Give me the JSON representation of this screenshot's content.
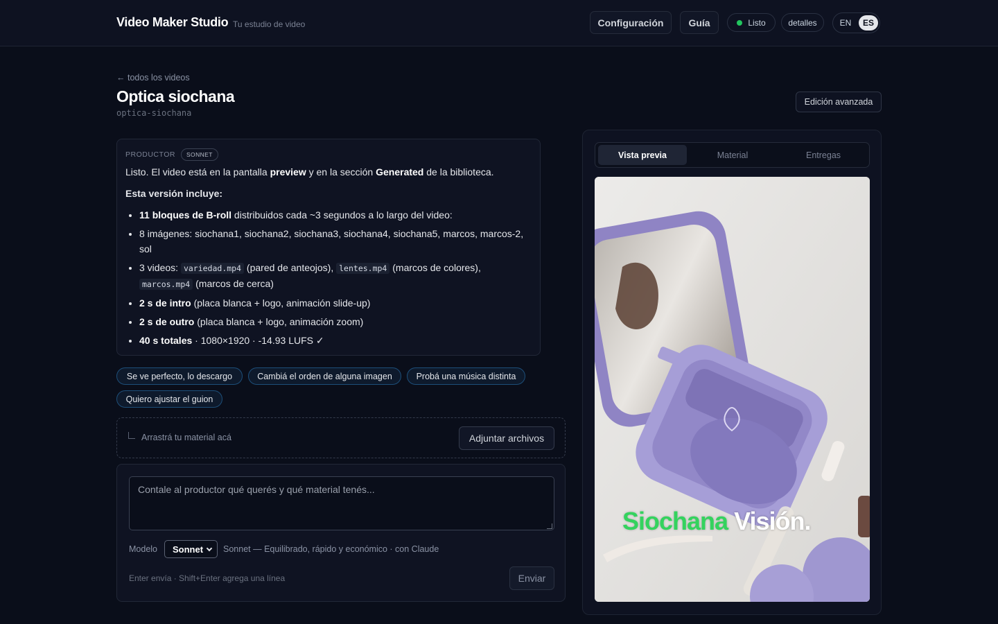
{
  "header": {
    "brand": "Video Maker Studio",
    "tagline": "Tu estudio de video",
    "config_label": "Configuración",
    "guide_label": "Guía",
    "status_label": "Listo",
    "details_label": "detalles",
    "lang_en": "EN",
    "lang_es": "ES"
  },
  "page": {
    "back_label": "← todos los videos",
    "title": "Optica siochana",
    "slug": "optica-siochana",
    "advanced_label": "Edición avanzada"
  },
  "message": {
    "author": "PRODUCTOR",
    "model_badge": "SONNET",
    "intro_a": "Listo. El video está en la pantalla ",
    "intro_b": "preview",
    "intro_c": " y en la sección ",
    "intro_d": "Generated",
    "intro_e": " de la biblioteca.",
    "includes": "Esta versión incluye:",
    "b1_bold": "11 bloques de B-roll",
    "b1_rest": " distribuidos cada ~3 segundos a lo largo del video:",
    "b2": "8 imágenes: siochana1, siochana2, siochana3, siochana4, siochana5, marcos, marcos-2, sol",
    "b3_a": "3 videos: ",
    "b3_code1": "variedad.mp4",
    "b3_b": " (pared de anteojos), ",
    "b3_code2": "lentes.mp4",
    "b3_c": " (marcos de colores), ",
    "b3_code3": "marcos.mp4",
    "b3_d": " (marcos de cerca)",
    "b4_bold": "2 s de intro",
    "b4_rest": " (placa blanca + logo, animación slide-up)",
    "b5_bold": "2 s de outro",
    "b5_rest": " (placa blanca + logo, animación zoom)",
    "b6_bold": "40 s totales",
    "b6_rest": " · 1080×1920 · -14.93 LUFS ✓"
  },
  "suggestions": [
    "Se ve perfecto, lo descargo",
    "Cambiá el orden de alguna imagen",
    "Probá una música distinta",
    "Quiero ajustar el guion"
  ],
  "dropzone": {
    "text": "Arrastrá tu material acá",
    "attach_label": "Adjuntar archivos"
  },
  "composer": {
    "placeholder": "Contale al productor qué querés y qué material tenés...",
    "model_label": "Modelo",
    "model_value": "Sonnet",
    "model_desc": "Sonnet — Equilibrado, rápido y económico · con Claude",
    "hint": "Enter envía · Shift+Enter agrega una línea",
    "send_label": "Enviar"
  },
  "panel": {
    "tabs": [
      "Vista previa",
      "Material",
      "Entregas"
    ],
    "active_tab": "Vista previa",
    "caption_a": "Siochana",
    "caption_b": "Visión."
  },
  "colors": {
    "background": "#0a0e1a",
    "status_dot": "#22c55e",
    "chip_border": "#1d4f7a",
    "caption_green": "#34d35e"
  }
}
